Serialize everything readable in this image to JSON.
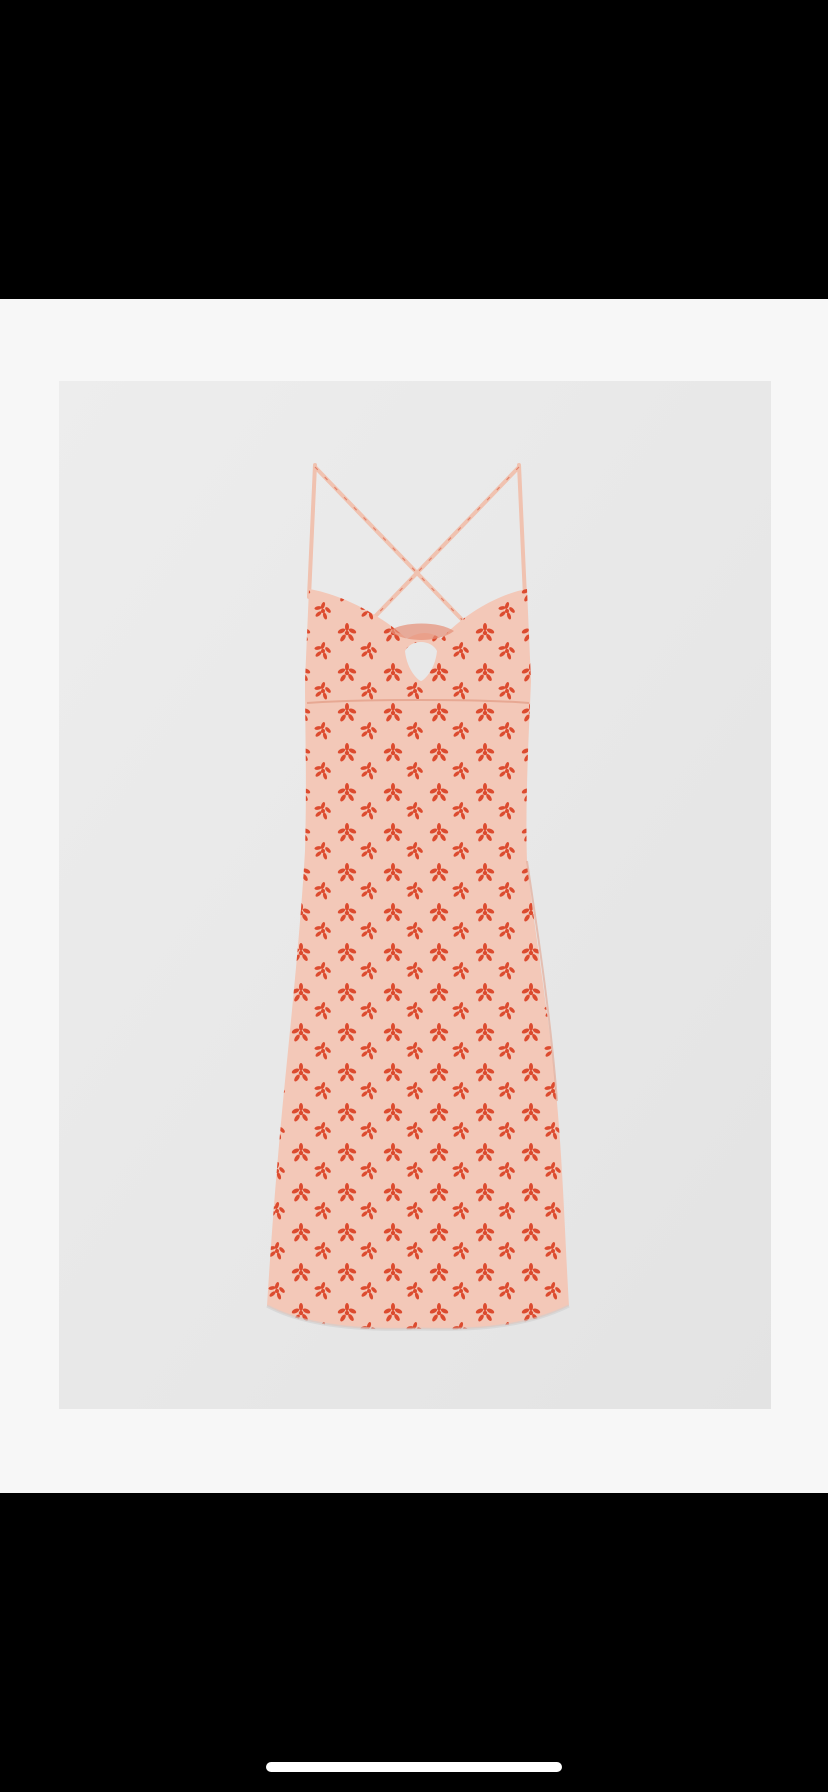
{
  "viewer": {
    "background_color": "#f7f7f7",
    "photo_background_color": "#eaeaea"
  },
  "product_photo": {
    "subject": "dress-icon",
    "fabric_color": "#f3c8b8",
    "print_color": "#dc4b2f"
  },
  "system": {
    "home_indicator_color": "#ffffff"
  }
}
